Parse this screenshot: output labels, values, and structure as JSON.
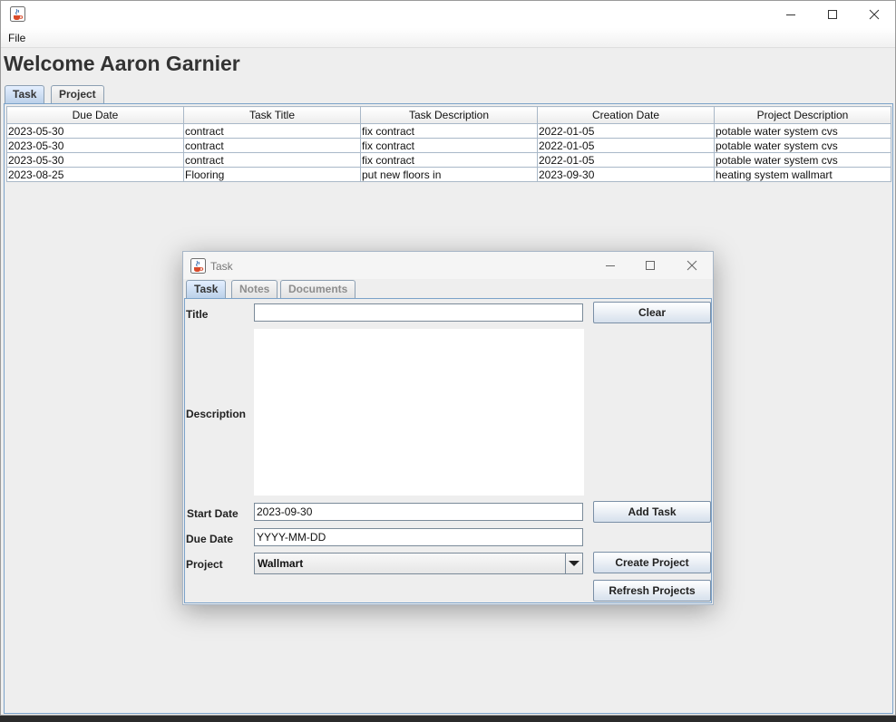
{
  "app": {
    "menu": {
      "file": "File"
    },
    "welcome": "Welcome Aaron Garnier",
    "tabs": [
      "Task",
      "Project"
    ],
    "table": {
      "columns": [
        "Due Date",
        "Task Title",
        "Task Description",
        "Creation Date",
        "Project Description"
      ],
      "rows": [
        [
          "2023-05-30",
          "contract",
          "fix contract",
          "2022-01-05",
          "potable water system cvs"
        ],
        [
          "2023-05-30",
          "contract",
          "fix contract",
          "2022-01-05",
          "potable water system cvs"
        ],
        [
          "2023-05-30",
          "contract",
          "fix contract",
          "2022-01-05",
          "potable water system cvs"
        ],
        [
          "2023-08-25",
          "Flooring",
          "put new floors in",
          "2023-09-30",
          "heating system wallmart"
        ]
      ]
    }
  },
  "dialog": {
    "title": "Task",
    "tabs": [
      "Task",
      "Notes",
      "Documents"
    ],
    "labels": {
      "title": "Title",
      "description": "Description",
      "start_date": "Start Date",
      "due_date": "Due Date",
      "project": "Project"
    },
    "fields": {
      "title": "",
      "start_date": "2023-09-30",
      "due_date": "YYYY-MM-DD",
      "project": "Wallmart"
    },
    "buttons": {
      "clear": "Clear",
      "add_task": "Add Task",
      "create_project": "Create Project",
      "refresh_projects": "Refresh Projects"
    }
  },
  "icons": {
    "app": "java-coffee-cup-icon",
    "minimize": "minimize-icon",
    "maximize": "maximize-icon",
    "close": "close-icon",
    "dropdown": "chevron-down-icon"
  },
  "colors": {
    "tab_border": "#7ba2c9",
    "active_tab": "#b9cfe8",
    "window_bg": "#eeeeee",
    "button_gradient_end": "#d6e0ec"
  }
}
